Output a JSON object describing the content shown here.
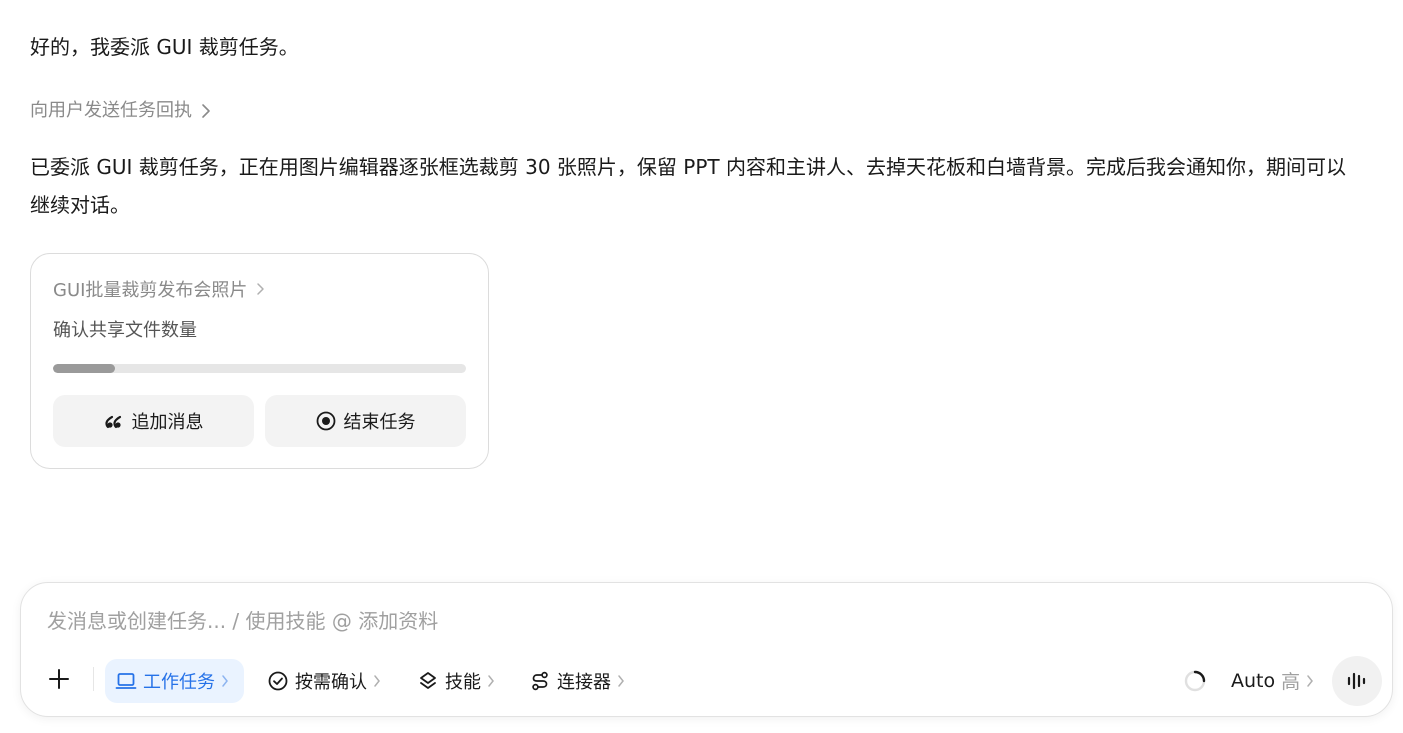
{
  "conversation": {
    "message_1": "好的，我委派 GUI 裁剪任务。",
    "receipt_link": "向用户发送任务回执",
    "message_2": "已委派 GUI 裁剪任务，正在用图片编辑器逐张框选裁剪 30 张照片，保留 PPT 内容和主讲人、去掉天花板和白墙背景。完成后我会通知你，期间可以继续对话。"
  },
  "task_card": {
    "title": "GUI批量裁剪发布会照片",
    "status": "确认共享文件数量",
    "progress_fraction": 0.15,
    "add_message_label": "追加消息",
    "end_task_label": "结束任务"
  },
  "composer": {
    "placeholder": "发消息或创建任务... / 使用技能 @ 添加资料",
    "tools": {
      "work_task": "工作任务",
      "confirm_on_demand": "按需确认",
      "skills": "技能",
      "connectors": "连接器"
    },
    "model_name": "Auto",
    "model_level": "高"
  },
  "colors": {
    "accent": "#2672e8",
    "accent_bg": "#eaf3ff",
    "muted_text": "#8a8a8a"
  }
}
